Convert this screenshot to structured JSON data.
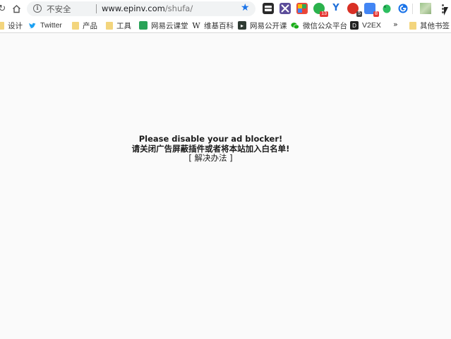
{
  "browser": {
    "security_label": "不安全",
    "url_host": "www.epinv.com",
    "url_path": "/shufa/",
    "extensions": [
      {
        "name": "extension-icon",
        "color": "#333333"
      },
      {
        "name": "extension-icon",
        "color": "#5c4d9a"
      },
      {
        "name": "extension-icon",
        "color": "#e94b3c"
      },
      {
        "name": "extension-icon",
        "color": "#2bb24c",
        "badge": "13"
      },
      {
        "name": "extension-icon",
        "color": "#1e6fd9"
      },
      {
        "name": "extension-icon",
        "color": "#d93025",
        "badge": "5"
      },
      {
        "name": "extension-icon",
        "color": "#4285f4",
        "badge": "8"
      },
      {
        "name": "extension-icon",
        "color": "#2dbe60"
      },
      {
        "name": "extension-icon",
        "color": "#1a73e8"
      }
    ]
  },
  "bookmarks": {
    "items": [
      "设计",
      "Twitter",
      "产品",
      "工具",
      "网易云课堂",
      "维基百科",
      "网易公开课",
      "微信公众平台",
      "V2EX"
    ],
    "more": "»",
    "other": "其他书签"
  },
  "page": {
    "line1": "Please disable your ad blocker!",
    "line2": "请关闭广告屏蔽插件或者将本站加入白名单!",
    "fix_open": "[",
    "fix_link": "解决办法",
    "fix_close": "]"
  }
}
